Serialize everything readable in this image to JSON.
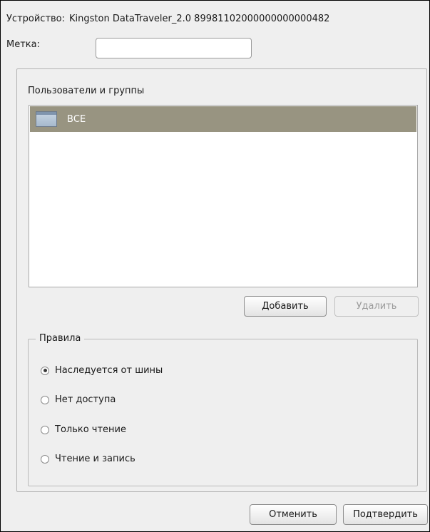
{
  "device": {
    "label": "Устройство:",
    "value": "Kingston DataTraveler_2.0 89981102000000000000482"
  },
  "tag": {
    "label": "Метка:",
    "value": "",
    "placeholder": ""
  },
  "users_groups": {
    "title": "Пользователи и группы",
    "items": [
      {
        "label": "ВСЕ",
        "icon": "window-icon",
        "selected": true
      }
    ],
    "add_label": "Добавить",
    "delete_label": "Удалить"
  },
  "rules": {
    "title": "Правила",
    "options": [
      {
        "label": "Наследуется от шины",
        "checked": true
      },
      {
        "label": "Нет доступа",
        "checked": false
      },
      {
        "label": "Только чтение",
        "checked": false
      },
      {
        "label": "Чтение и запись",
        "checked": false
      }
    ]
  },
  "footer": {
    "cancel_label": "Отменить",
    "confirm_label": "Подтвердить"
  },
  "colors": {
    "selection": "#989481",
    "window_bg": "#efefef"
  }
}
